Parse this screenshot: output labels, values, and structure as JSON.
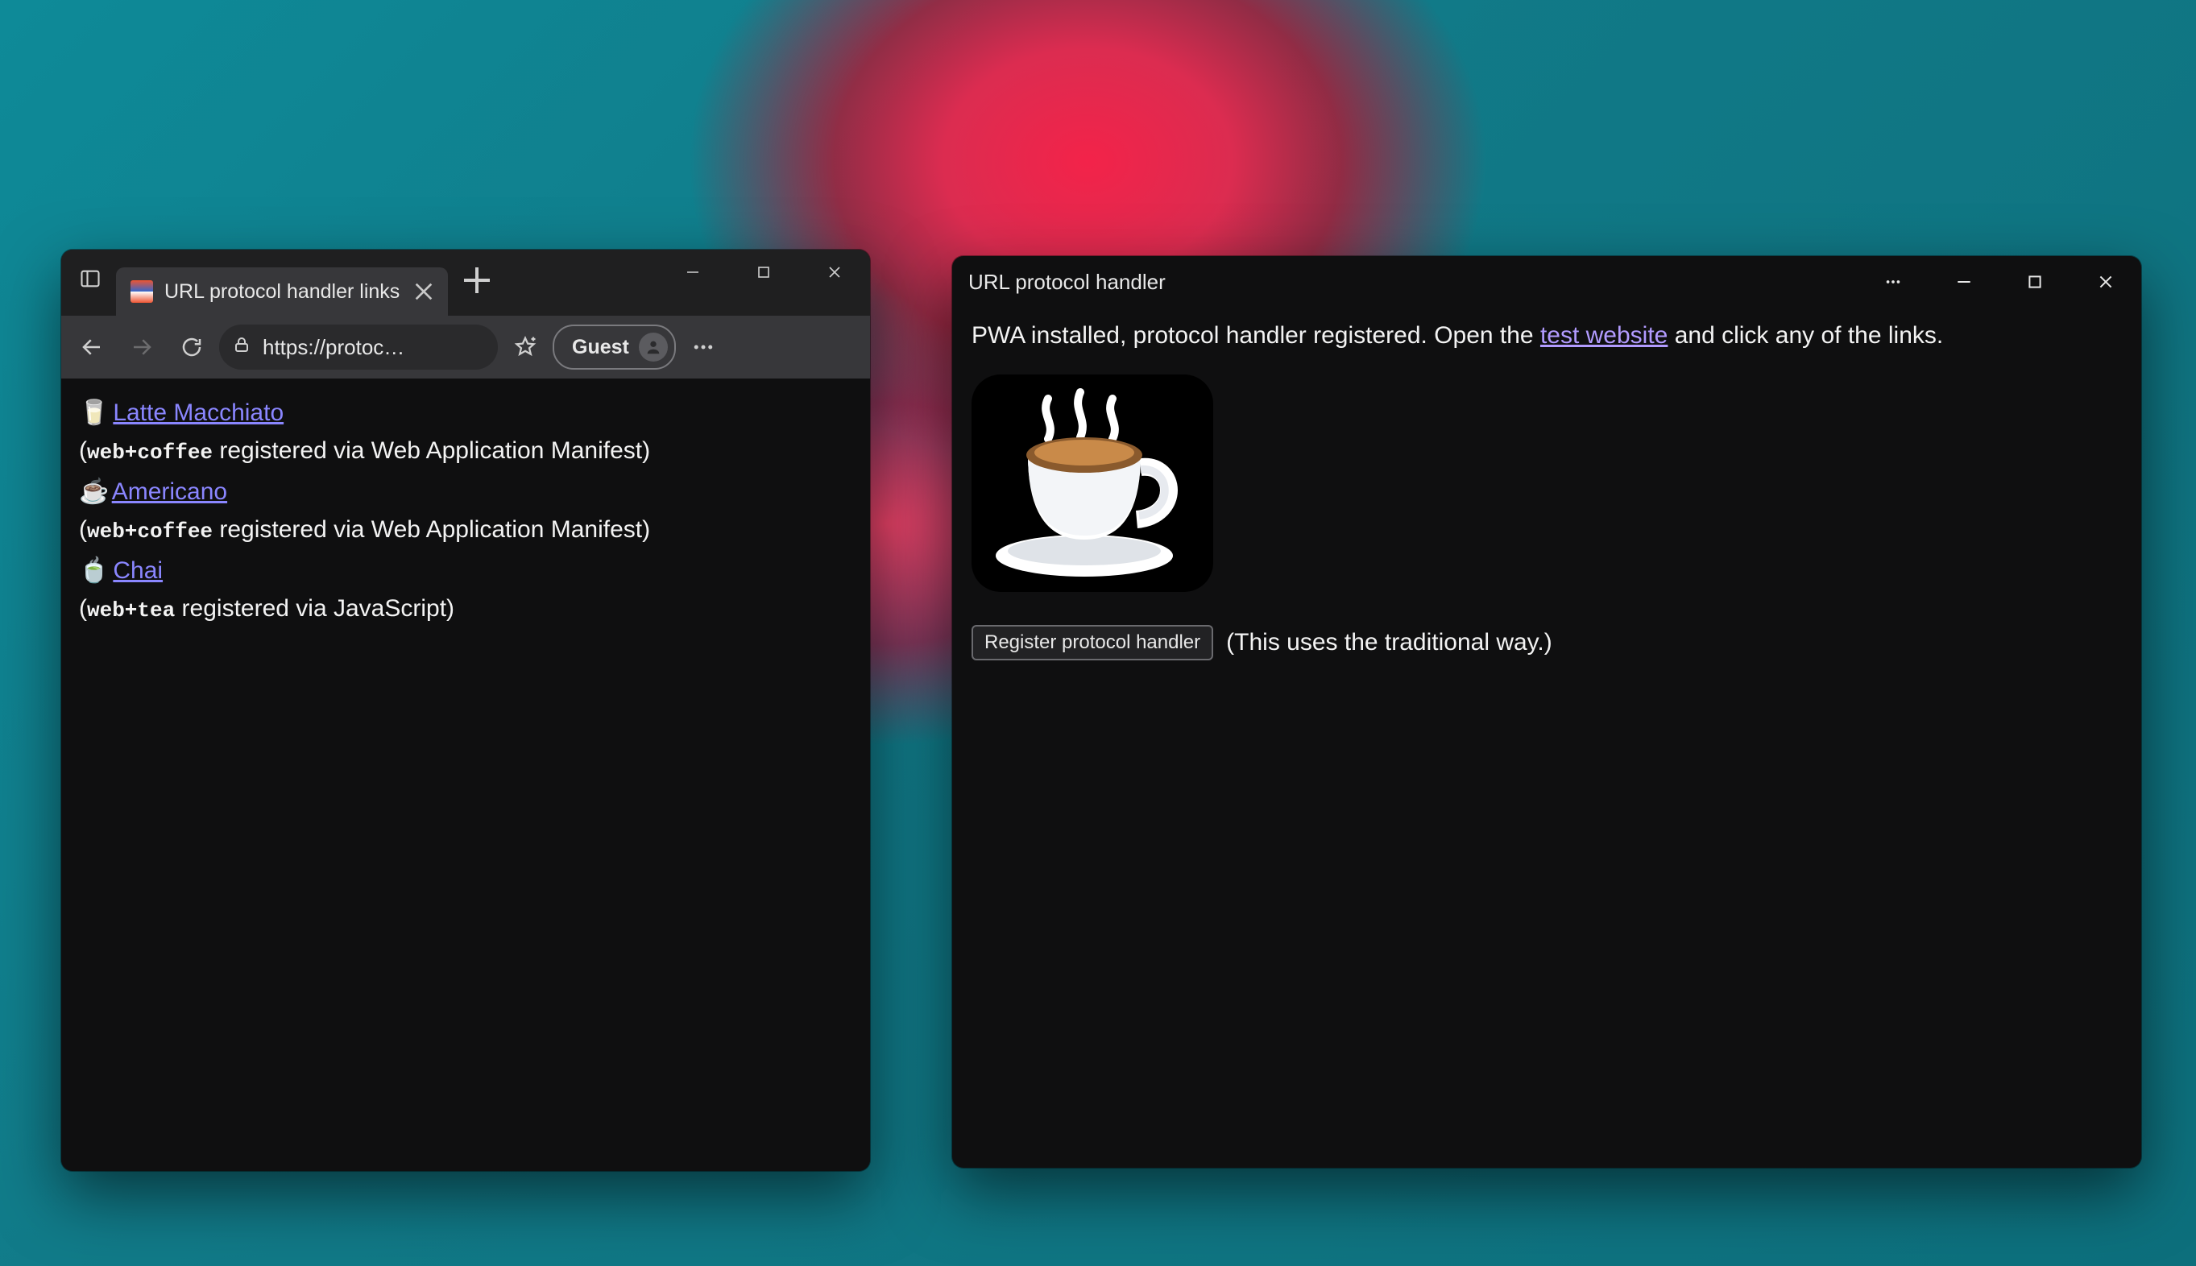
{
  "browser": {
    "tab": {
      "title": "URL protocol handler links"
    },
    "address": {
      "url": "https://protoc…"
    },
    "profile_label": "Guest",
    "page": {
      "links": [
        {
          "emoji": "🥛",
          "label": "Latte Macchiato",
          "proto": "web+coffee",
          "via": " registered via Web Application Manifest)"
        },
        {
          "emoji": "☕",
          "label": "Americano",
          "proto": "web+coffee",
          "via": " registered via Web Application Manifest)"
        },
        {
          "emoji": "🍵",
          "label": "Chai",
          "proto": "web+tea",
          "via": " registered via JavaScript)"
        }
      ]
    }
  },
  "pwa": {
    "title": "URL protocol handler",
    "intro": {
      "before": "PWA installed, protocol handler registered. Open the ",
      "link": "test website",
      "after": " and click any of the links."
    },
    "register_button": "Register protocol handler",
    "register_note": "(This uses the traditional way.)"
  }
}
